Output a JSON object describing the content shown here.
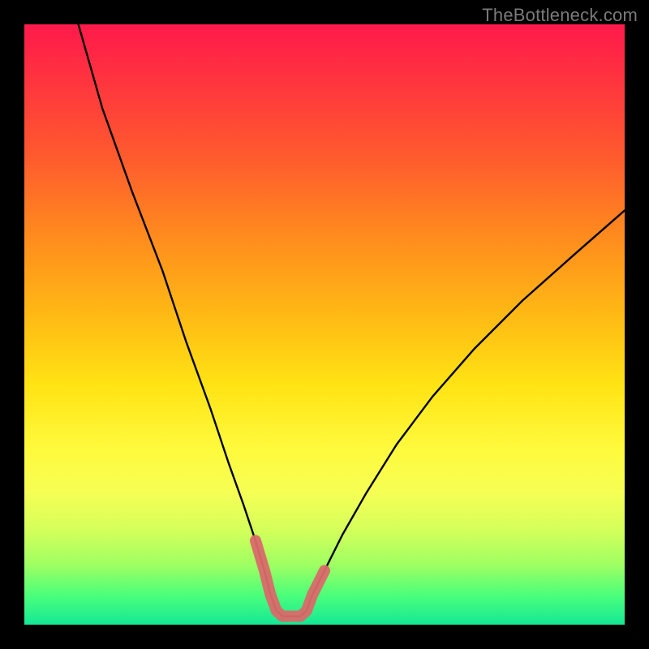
{
  "watermark": "TheBottleneck.com",
  "chart_data": {
    "type": "line",
    "title": "",
    "xlabel": "",
    "ylabel": "",
    "ylim": [
      0,
      100
    ],
    "xlim": [
      0,
      100
    ],
    "curve_black": {
      "name": "bottleneck-curve",
      "x": [
        9,
        13,
        18,
        23,
        27,
        31,
        34,
        36.5,
        38.5,
        40,
        41,
        42,
        43,
        46,
        47,
        48,
        50,
        53,
        57,
        62,
        68,
        75,
        83,
        92,
        100
      ],
      "y": [
        100,
        86,
        72,
        59,
        47,
        36,
        27,
        20,
        14,
        9,
        5,
        2.3,
        1.4,
        1.4,
        2.3,
        5,
        9,
        15,
        22,
        30,
        38,
        46,
        54,
        62,
        69
      ]
    },
    "highlight_pink": {
      "name": "valley-highlight",
      "x": [
        38.5,
        40,
        41,
        42,
        43,
        46,
        47,
        48,
        50
      ],
      "y": [
        14,
        9,
        5,
        2.3,
        1.4,
        1.4,
        2.3,
        5,
        9
      ]
    },
    "colors": {
      "curve": "#000000",
      "highlight": "#d96a6a"
    }
  }
}
